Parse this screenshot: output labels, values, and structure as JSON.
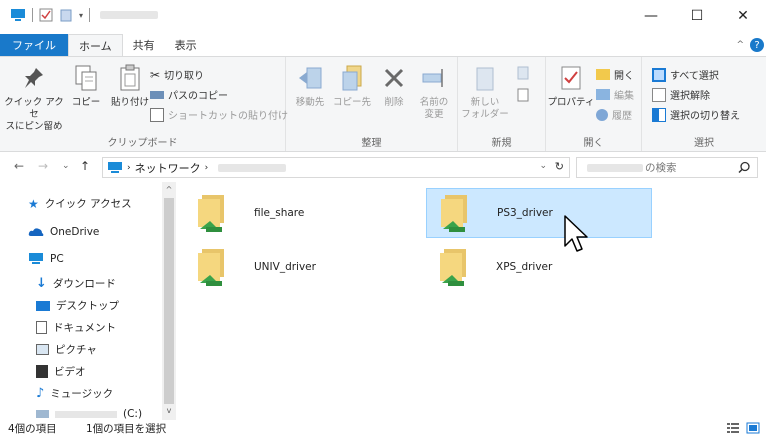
{
  "window": {
    "minimize": "—",
    "maximize": "☐",
    "close": "✕"
  },
  "tabs": {
    "file": "ファイル",
    "home": "ホーム",
    "share": "共有",
    "view": "表示"
  },
  "ribbon": {
    "clipboard": {
      "label": "クリップボード",
      "pin_line1": "クイック アクセ",
      "pin_line2": "スにピン留め",
      "copy": "コピー",
      "paste": "貼り付け",
      "cut": "切り取り",
      "copy_path": "パスのコピー",
      "paste_shortcut": "ショートカットの貼り付け"
    },
    "organize": {
      "label": "整理",
      "move_to": "移動先",
      "copy_to": "コピー先",
      "delete": "削除",
      "rename_line1": "名前の",
      "rename_line2": "変更"
    },
    "new": {
      "label": "新規",
      "new_folder_line1": "新しい",
      "new_folder_line2": "フォルダー"
    },
    "open": {
      "label": "開く",
      "properties": "プロパティ",
      "open": "開く",
      "edit": "編集",
      "history": "履歴"
    },
    "select": {
      "label": "選択",
      "select_all": "すべて選択",
      "select_none": "選択解除",
      "invert": "選択の切り替え"
    }
  },
  "address": {
    "network": "ネットワーク",
    "search_suffix": "の検索"
  },
  "nav": {
    "quick_access": "クイック アクセス",
    "onedrive": "OneDrive",
    "pc": "PC",
    "downloads": "ダウンロード",
    "desktop": "デスクトップ",
    "documents": "ドキュメント",
    "pictures": "ピクチャ",
    "videos": "ビデオ",
    "music": "ミュージック",
    "drive_suffix": "(C:)"
  },
  "items": [
    {
      "name": "file_share"
    },
    {
      "name": "PS3_driver"
    },
    {
      "name": "UNIV_driver"
    },
    {
      "name": "XPS_driver"
    }
  ],
  "status": {
    "count": "4個の項目",
    "selected": "1個の項目を選択"
  }
}
